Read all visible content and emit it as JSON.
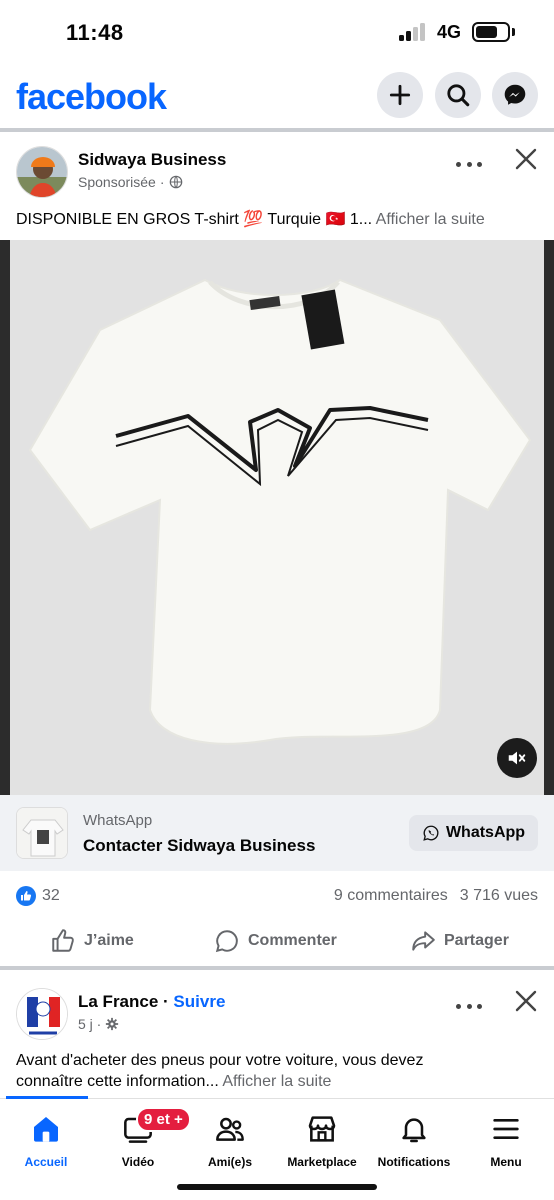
{
  "status_bar": {
    "time": "11:48",
    "network": "4G"
  },
  "header": {
    "logo": "facebook",
    "icons": [
      "plus-icon",
      "search-icon",
      "messenger-icon"
    ]
  },
  "post1": {
    "author": "Sidwaya Business",
    "meta": "Sponsorisée",
    "meta_separator": "·",
    "text": "DISPONIBLE EN GROS T-shirt 💯 Turquie 🇹🇷 1...",
    "see_more": "Afficher la suite",
    "cta": {
      "source": "WhatsApp",
      "title": "Contacter Sidwaya Business",
      "button_label": "WhatsApp"
    },
    "likes": "32",
    "comments": "9 commentaires",
    "views": "3 716 vues",
    "actions": {
      "like": "J’aime",
      "comment": "Commenter",
      "share": "Partager"
    }
  },
  "post2": {
    "author": "La France",
    "follow_sep": " · ",
    "follow": "Suivre",
    "meta": "5 j ·",
    "text_line1": "Avant d'acheter des pneus pour votre voiture, vous devez",
    "text_line2": "connaître cette information...",
    "see_more": "Afficher la suite"
  },
  "bottom_nav": {
    "items": [
      {
        "label": "Accueil",
        "icon": "home-icon",
        "active": true
      },
      {
        "label": "Vidéo",
        "icon": "video-icon",
        "badge": "9 et +"
      },
      {
        "label": "Ami(e)s",
        "icon": "friends-icon"
      },
      {
        "label": "Marketplace",
        "icon": "marketplace-icon"
      },
      {
        "label": "Notifications",
        "icon": "bell-icon"
      },
      {
        "label": "Menu",
        "icon": "menu-icon"
      }
    ]
  },
  "colors": {
    "brand": "#0866ff",
    "badge": "#e41e3f",
    "muted": "#65676b"
  }
}
